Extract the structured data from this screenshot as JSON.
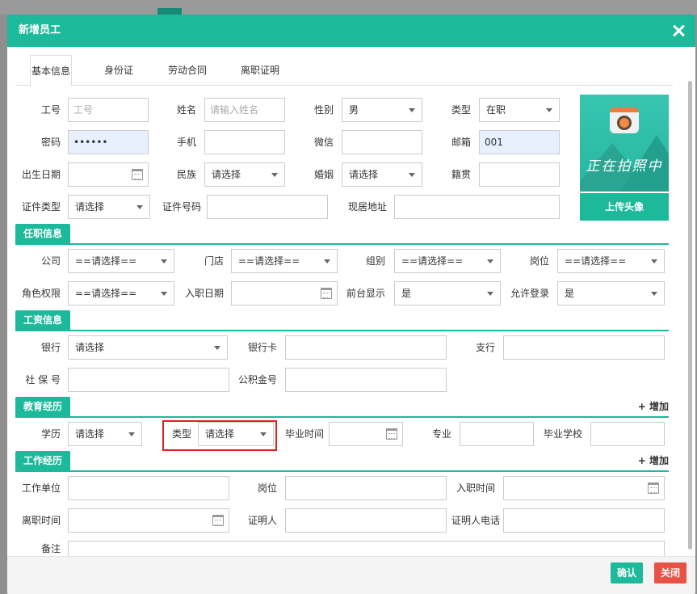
{
  "dialog": {
    "title": "新增员工",
    "tabs": [
      "基本信息",
      "身份证",
      "劳动合同",
      "离职证明"
    ],
    "upload_label": "上传头像",
    "photo_text": "正在拍照中",
    "confirm_label": "确认",
    "close_label": "关闭"
  },
  "basic": {
    "gonghao_label": "工号",
    "gonghao_placeholder": "工号",
    "name_label": "姓名",
    "name_placeholder": "请输入姓名",
    "gender_label": "性别",
    "gender_value": "男",
    "type_label": "类型",
    "type_value": "在职",
    "password_label": "密码",
    "password_value": "••••••",
    "phone_label": "手机",
    "wechat_label": "微信",
    "email_label": "邮箱",
    "email_value": "001",
    "birth_label": "出生日期",
    "ethnic_label": "民族",
    "ethnic_value": "请选择",
    "marriage_label": "婚姻",
    "marriage_value": "请选择",
    "origin_label": "籍贯",
    "idtype_label": "证件类型",
    "idtype_value": "请选择",
    "idno_label": "证件号码",
    "address_label": "现居地址"
  },
  "job": {
    "section_title": "任职信息",
    "company_label": "公司",
    "company_value": "==请选择==",
    "store_label": "门店",
    "store_value": "==请选择==",
    "group_label": "组别",
    "group_value": "==请选择==",
    "post_label": "岗位",
    "post_value": "==请选择==",
    "role_label": "角色权限",
    "role_value": "==请选择==",
    "entry_label": "入职日期",
    "front_label": "前台显示",
    "front_value": "是",
    "login_label": "允许登录",
    "login_value": "是"
  },
  "salary": {
    "section_title": "工资信息",
    "bank_label": "银行",
    "bank_value": "请选择",
    "card_label": "银行卡",
    "branch_label": "支行",
    "social_label": "社 保 号",
    "fund_label": "公积金号"
  },
  "education": {
    "section_title": "教育经历",
    "add_label": "+ 增加",
    "degree_label": "学历",
    "degree_value": "请选择",
    "type_label": "类型",
    "type_value": "请选择",
    "grad_label": "毕业时间",
    "major_label": "专业",
    "school_label": "毕业学校"
  },
  "work": {
    "section_title": "工作经历",
    "add_label": "+ 增加",
    "unit_label": "工作单位",
    "post_label": "岗位",
    "entry_label": "入职时间",
    "leave_label": "离职时间",
    "witness_label": "证明人",
    "witness_phone_label": "证明人电话",
    "remark_label": "备注"
  },
  "colors": {
    "accent": "#1cb99a",
    "danger": "#e85245",
    "highlight": "#e02020"
  }
}
